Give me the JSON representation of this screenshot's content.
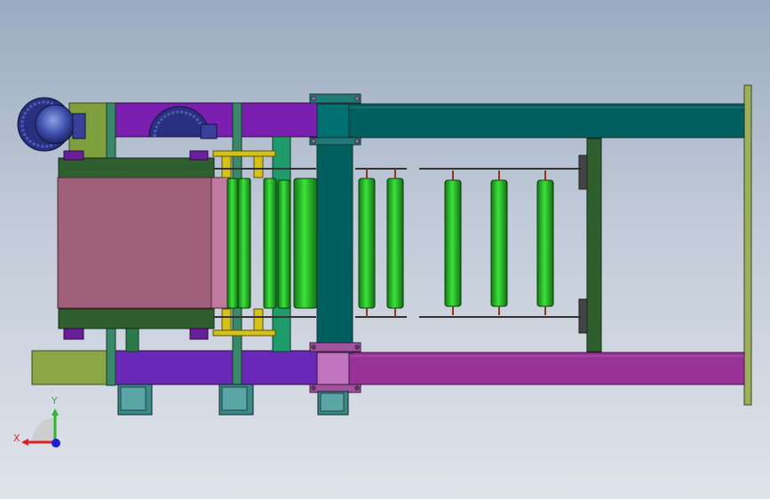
{
  "viewport": {
    "background_top": "#9aabc1",
    "background_bottom": "#dfe3ea"
  },
  "triad": {
    "x_label": "X",
    "y_label": "Y",
    "x_color": "#e0221d",
    "y_color": "#2fb52f",
    "z_color": "#2020d0"
  },
  "colors": {
    "teal_beam": "#005f5f",
    "purple_rail": "#7a1fb0",
    "magenta_rail": "#993399",
    "olive": "#7f9f3f",
    "green_roller": "#22bb22",
    "pink_panel": "#a0607a",
    "dark_green_bracket": "#2f5f2f",
    "motor_body": "#3a8a8a",
    "blower_blue": "#3a4aa0",
    "yellow_part": "#d4c21a"
  },
  "rollers_left_count": 7,
  "rollers_right_count": 5
}
